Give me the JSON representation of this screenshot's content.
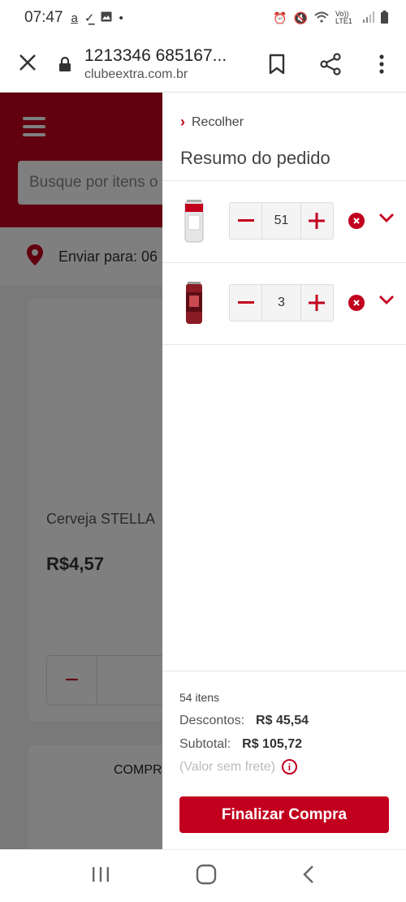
{
  "status_bar": {
    "time": "07:47",
    "left_icons": [
      "amazon-icon",
      "download-done-icon",
      "image-icon",
      "dot-icon"
    ],
    "right_icons": [
      "alarm-icon",
      "mute-icon",
      "wifi-icon",
      "volte-icon",
      "signal-icon",
      "battery-icon"
    ],
    "network_label": "Vo)) LTE1"
  },
  "browser": {
    "page_title": "1213346 685167...",
    "domain": "clubeextra.com.br"
  },
  "background_page": {
    "search_placeholder": "Busque por itens o",
    "ship_to": "Enviar para: 06",
    "product_name": "Cerveja STELLA",
    "product_price": "R$4,57",
    "qty_minus": "−",
    "compre_label": "COMPRE"
  },
  "drawer": {
    "collapse_label": "Recolher",
    "title": "Resumo do pedido",
    "items": [
      {
        "name": "cerveja-stella-lata",
        "quantity": "51"
      },
      {
        "name": "cerveja-lata-vermelha",
        "quantity": "3"
      }
    ],
    "summary": {
      "items_count": "54 itens",
      "discount_label": "Descontos:",
      "discount_value": "R$ 45,54",
      "subtotal_label": "Subtotal:",
      "subtotal_value": "R$ 105,72",
      "note": "(Valor sem frete)",
      "checkout_label": "Finalizar Compra"
    }
  },
  "colors": {
    "brand_red": "#c2001e"
  }
}
